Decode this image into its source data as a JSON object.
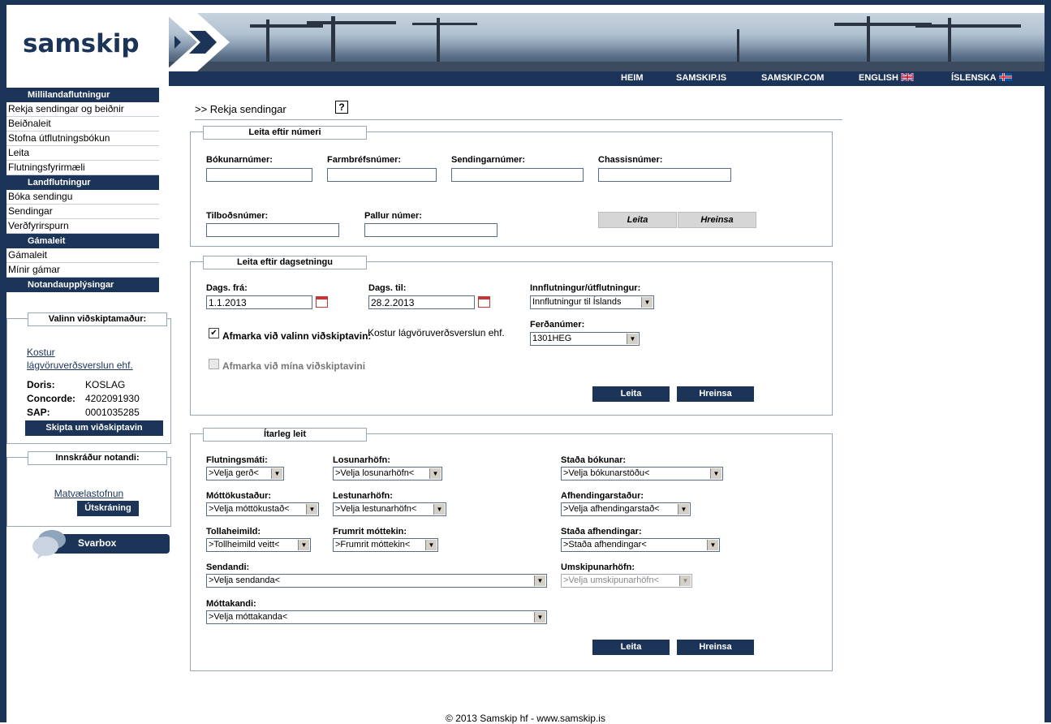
{
  "brand": {
    "logo": "samskip"
  },
  "nav": {
    "heim": "HEIM",
    "samskip_is": "SAMSKIP.IS",
    "samskip_com": "SAMSKIP.COM",
    "english": "ENGLISH",
    "islenska": "ÍSLENSKA"
  },
  "sidebar": {
    "sections": [
      {
        "title": "Millilandaflutningur",
        "items": [
          "Rekja sendingar og beiðnir",
          "Beiðnaleit",
          "Stofna útflutningsbókun",
          "Leita",
          "Flutningsfyrirmæli"
        ]
      },
      {
        "title": "Landflutningur",
        "items": [
          "Bóka sendingu",
          "Sendingar",
          "Verðfyrirspurn"
        ]
      },
      {
        "title": "Gámaleit",
        "items": [
          "Gámaleit",
          "Mínir gámar"
        ]
      },
      {
        "title": "Notandaupplýsingar",
        "items": []
      }
    ],
    "customer_box": {
      "title": "Valinn viðskiptamaður:",
      "customer_link": "Kostur lágvöruverðsverslun ehf.",
      "rows": [
        {
          "label": "Doris:",
          "value": "KOSLAG"
        },
        {
          "label": "Concorde:",
          "value": "4202091930"
        },
        {
          "label": "SAP:",
          "value": "0001035285"
        }
      ],
      "switch_button": "Skipta um viðskiptavin"
    },
    "user_box": {
      "title": "Innskráður notandi:",
      "user_link": "Matvælastofnun",
      "logout_button": "Útskráning"
    },
    "svarbox": "Svarbox"
  },
  "main": {
    "title": ">> Rekja sendingar",
    "help": "?",
    "by_number": {
      "legend": "Leita eftir númeri",
      "booking_label": "Bókunarnúmer:",
      "waybill_label": "Farmbréfsnúmer:",
      "shipment_label": "Sendingarnúmer:",
      "chassis_label": "Chassisnúmer:",
      "offer_label": "Tilboðsnúmer:",
      "pallet_label": "Pallur númer:",
      "search_button": "Leita",
      "clear_button": "Hreinsa"
    },
    "by_date": {
      "legend": "Leita eftir dagsetningu",
      "from_label": "Dags. frá:",
      "from_value": "1.1.2013",
      "to_label": "Dags. til:",
      "to_value": "28.2.2013",
      "direction_label": "Innflutningur/útflutningur:",
      "direction_value": "Innflutningur til Íslands",
      "restrict_selected_label": "Afmarka við valinn viðskiptavin:",
      "restrict_selected_checked": true,
      "selected_customer": "Kostur lágvöruverðsverslun ehf.",
      "voyage_label": "Ferðanúmer:",
      "voyage_value": "1301HEG",
      "restrict_mine_label": "Afmarka við mína viðskiptavini",
      "search_button": "Leita",
      "clear_button": "Hreinsa"
    },
    "advanced": {
      "legend": "Ítarleg leit",
      "transport_label": "Flutningsmáti:",
      "transport_value": ">Velja gerð<",
      "discharge_label": "Losunarhöfn:",
      "discharge_value": ">Velja losunarhöfn<",
      "booking_status_label": "Staða bókunar:",
      "booking_status_value": ">Velja bókunarstöðu<",
      "receipt_label": "Móttökustaður:",
      "receipt_value": ">Velja móttökustað<",
      "loading_label": "Lestunarhöfn:",
      "loading_value": ">Velja lestunarhöfn<",
      "delivery_place_label": "Afhendingarstaður:",
      "delivery_place_value": ">Velja afhendingarstað<",
      "customs_label": "Tollaheimild:",
      "customs_value": ">Tollheimild veitt<",
      "original_label": "Frumrit móttekin:",
      "original_value": ">Frumrit móttekin<",
      "delivery_status_label": "Staða afhendingar:",
      "delivery_status_value": ">Staða afhendingar<",
      "sender_label": "Sendandi:",
      "sender_value": ">Velja sendanda<",
      "transship_label": "Umskipunarhöfn:",
      "transship_value": ">Velja umskipunarhöfn<",
      "receiver_label": "Móttakandi:",
      "receiver_value": ">Velja móttakanda<",
      "search_button": "Leita",
      "clear_button": "Hreinsa"
    }
  },
  "footer": "© 2013 Samskip hf - www.samskip.is",
  "colors": {
    "brand_navy": "#1c3458",
    "border": "#9aa7b6",
    "calendar_red": "#cc3333"
  }
}
